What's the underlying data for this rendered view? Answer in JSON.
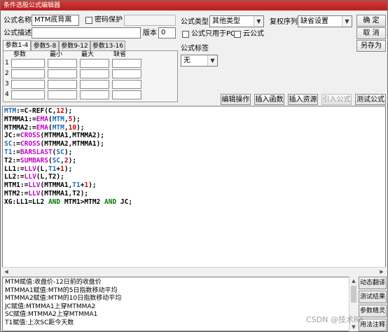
{
  "window": {
    "title": "条件选股公式编辑器"
  },
  "form": {
    "name_label": "公式名称",
    "name_value": "MTM底背离",
    "password_label": "密码保护",
    "desc_label": "公式描述",
    "desc_value": "",
    "version_label": "版本",
    "version_value": "0",
    "type_label": "公式类型",
    "type_value": "其他类型",
    "order_label": "复权序列",
    "order_value": "缺省设置",
    "pc_only_label": "公式只用于PC",
    "cloud_label": "云公式",
    "tag_label": "公式标签",
    "tag_value": "无"
  },
  "buttons": {
    "ok": "确 定",
    "cancel": "取 消",
    "save_as": "另存为",
    "edit_op": "编辑操作",
    "insert_func": "插入函数",
    "insert_res": "插入资源",
    "import_formula": "引入公式",
    "test_formula": "测试公式"
  },
  "params": {
    "tabs": [
      "参数1-4",
      "参数5-8",
      "参数9-12",
      "参数13-16"
    ],
    "headers": [
      "参数",
      "最小",
      "最大",
      "缺省"
    ],
    "rows": [
      "1",
      "2",
      "3",
      "4"
    ]
  },
  "code": [
    [
      [
        "MTM",
        "var"
      ],
      [
        ":=C-REF(C,",
        "op"
      ],
      [
        "12",
        "num"
      ],
      [
        ");",
        "op"
      ]
    ],
    [
      [
        "MTMMA1",
        "op"
      ],
      [
        ":=",
        "op"
      ],
      [
        "EMA",
        "fn"
      ],
      [
        "(",
        "op"
      ],
      [
        "MTM",
        "var"
      ],
      [
        ",",
        "op"
      ],
      [
        "5",
        "num"
      ],
      [
        ");",
        "op"
      ]
    ],
    [
      [
        "MTMMA2",
        "op"
      ],
      [
        ":=",
        "op"
      ],
      [
        "EMA",
        "fn"
      ],
      [
        "(",
        "op"
      ],
      [
        "MTM",
        "var"
      ],
      [
        ",",
        "op"
      ],
      [
        "10",
        "num"
      ],
      [
        ");",
        "op"
      ]
    ],
    [
      [
        "JC",
        "op"
      ],
      [
        ":=",
        "op"
      ],
      [
        "CROSS",
        "fn"
      ],
      [
        "(MTMMA1,MTMMA2);",
        "op"
      ]
    ],
    [
      [
        "SC",
        "var"
      ],
      [
        ":=",
        "op"
      ],
      [
        "CROSS",
        "fn"
      ],
      [
        "(MTMMA2,MTMMA1);",
        "op"
      ]
    ],
    [
      [
        "T1",
        "var"
      ],
      [
        ":=",
        "op"
      ],
      [
        "BARSLAST",
        "fn"
      ],
      [
        "(",
        "op"
      ],
      [
        "SC",
        "var"
      ],
      [
        ");",
        "op"
      ]
    ],
    [
      [
        "T2",
        "op"
      ],
      [
        ":=",
        "op"
      ],
      [
        "SUMBARS",
        "fn"
      ],
      [
        "(",
        "op"
      ],
      [
        "SC",
        "var"
      ],
      [
        ",",
        "op"
      ],
      [
        "2",
        "num"
      ],
      [
        ");",
        "op"
      ]
    ],
    [
      [
        "LL1",
        "op"
      ],
      [
        ":=",
        "op"
      ],
      [
        "LLV",
        "fn"
      ],
      [
        "(L,",
        "op"
      ],
      [
        "T1",
        "var"
      ],
      [
        "+",
        "op"
      ],
      [
        "1",
        "num"
      ],
      [
        ");",
        "op"
      ]
    ],
    [
      [
        "LL2",
        "op"
      ],
      [
        ":=",
        "op"
      ],
      [
        "LLV",
        "fn"
      ],
      [
        "(L,T2);",
        "op"
      ]
    ],
    [
      [
        "MTM1",
        "op"
      ],
      [
        ":=",
        "op"
      ],
      [
        "LLV",
        "fn"
      ],
      [
        "(MTMMA1,",
        "op"
      ],
      [
        "T1",
        "var"
      ],
      [
        "+",
        "op"
      ],
      [
        "1",
        "num"
      ],
      [
        ");",
        "op"
      ]
    ],
    [
      [
        "MTM2",
        "op"
      ],
      [
        ":=",
        "op"
      ],
      [
        "LLV",
        "fn"
      ],
      [
        "(MTMMA1,T2);",
        "op"
      ]
    ],
    [
      [
        "XG",
        "op"
      ],
      [
        ":LL1=LL2 ",
        "op"
      ],
      [
        "AND",
        "kw"
      ],
      [
        " MTM1>MTM2 ",
        "op"
      ],
      [
        "AND",
        "kw"
      ],
      [
        " JC;",
        "op"
      ]
    ]
  ],
  "description": [
    "MTM赋值:收盘价-12日前的收盘价",
    "MTMMA1赋值:MTM的5日指数移动平均",
    "MTMMA2赋值:MTM的10日指数移动平均",
    "JC赋值:MTMMA1上穿MTMMA2",
    "SC赋值:MTMMA2上穿MTMMA1",
    "T1赋值:上次SC距今天数"
  ],
  "side_buttons": [
    "动态翻译",
    "测试结果",
    "参数精灵",
    "用法注释"
  ],
  "watermark": "CSDN @技术Re",
  "colors": {
    "title_bar": "#c62828",
    "var": "#1a6bb4",
    "func": "#c800c8",
    "num": "#d40000",
    "keyword": "#007a00"
  }
}
